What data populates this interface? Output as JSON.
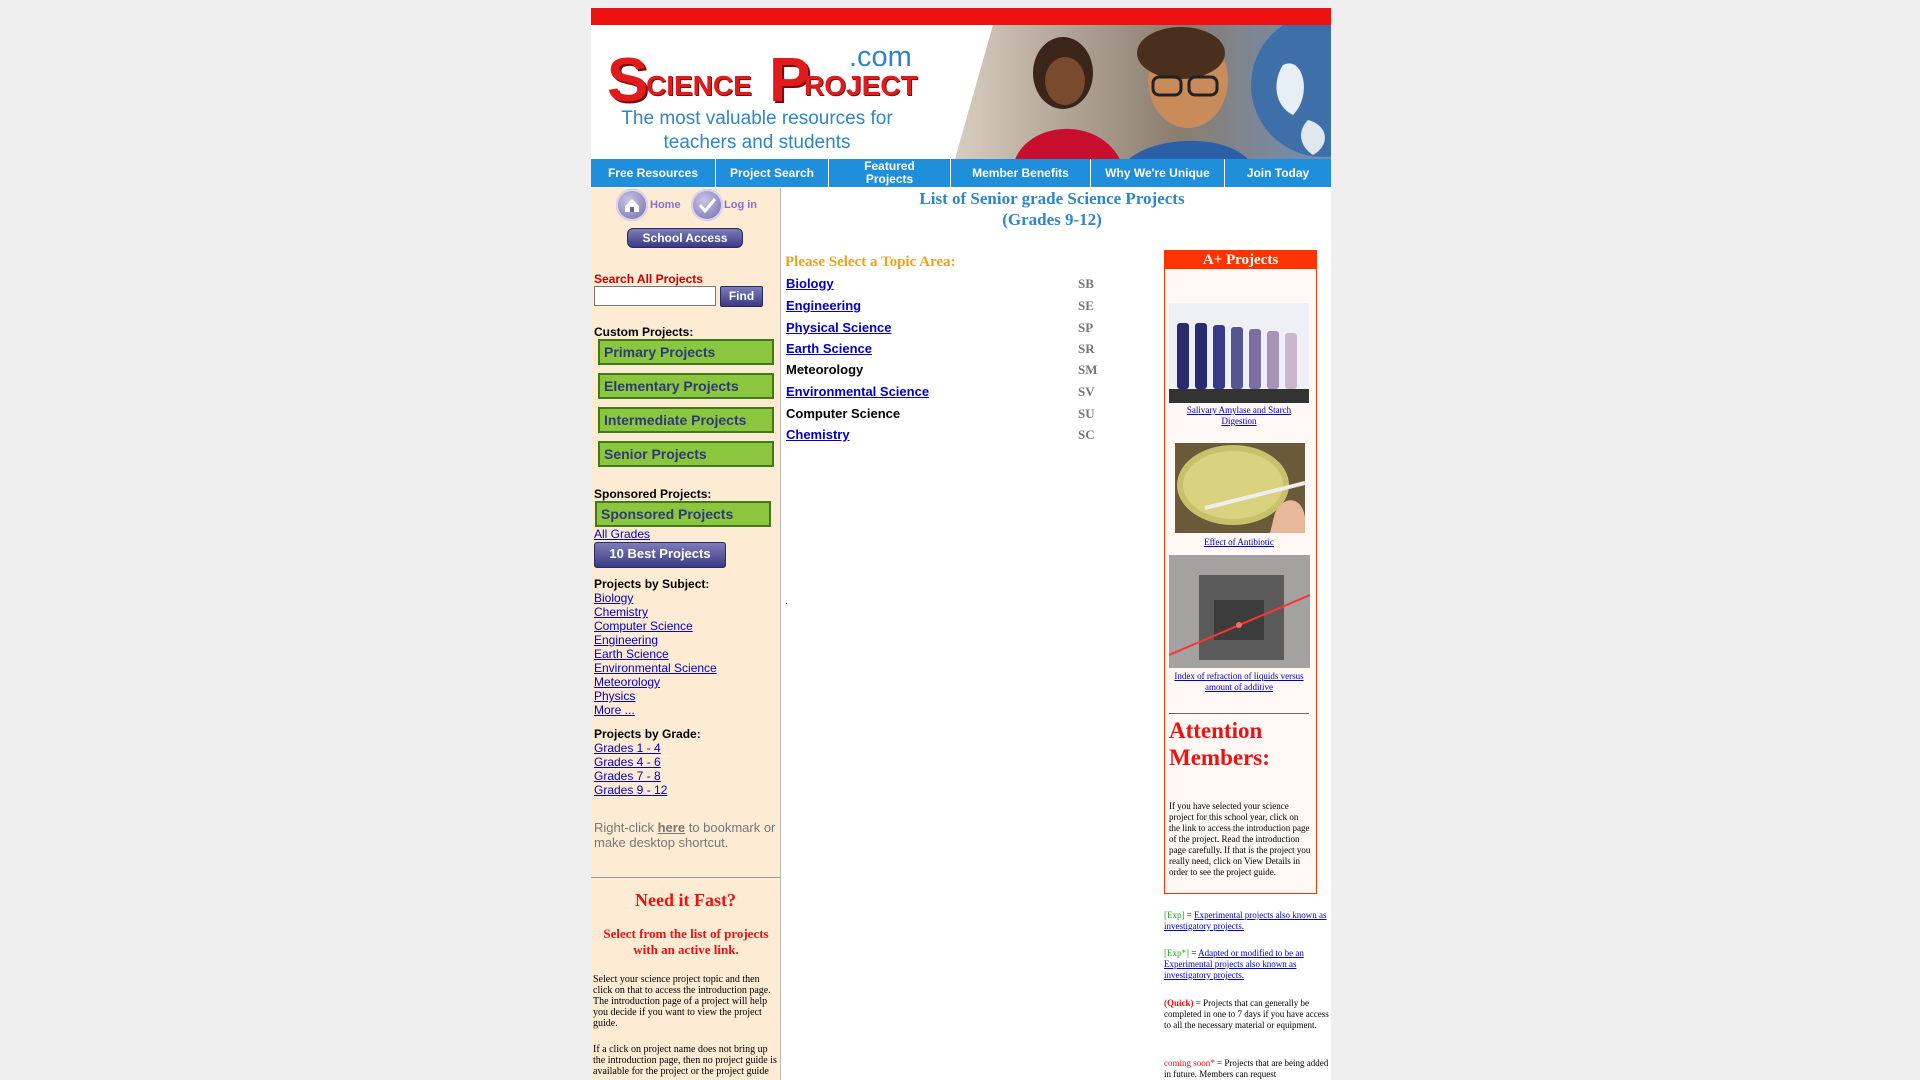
{
  "banner": {
    "logo_s": "S",
    "logo_cience": "CIENCE",
    "logo_p": "P",
    "logo_roject": "ROJECT",
    "logo_com": ".com",
    "tagline": "The most valuable resources for teachers and students"
  },
  "nav": [
    {
      "label": "Free Resources"
    },
    {
      "label": "Project Search"
    },
    {
      "label": "Featured Projects"
    },
    {
      "label": "Member Benefits"
    },
    {
      "label": "Why We're Unique"
    },
    {
      "label": "Join Today"
    }
  ],
  "sidebar": {
    "home": "Home",
    "login": "Log in",
    "school_access": "School Access",
    "search_label": "Search All Projects",
    "search_value": "",
    "find": "Find",
    "custom_label": "Custom Projects:",
    "custom": [
      "Primary Projects",
      "Elementary Projects",
      "Intermediate Projects",
      "Senior Projects"
    ],
    "sponsored_label": "Sponsored Projects:",
    "sponsored": "Sponsored Projects",
    "all_grades": "All Grades",
    "best": "10 Best Projects",
    "subject_label": "Projects by Subject:",
    "subjects": [
      "Biology",
      "Chemistry",
      "Computer Science",
      "Engineering",
      "Earth Science",
      "Environmental Science",
      "Meteorology",
      "Physics",
      "More ..."
    ],
    "grade_label": "Projects by Grade:",
    "grades": [
      "Grades 1 - 4",
      "Grades 4 - 6",
      "Grades 7 - 8",
      "Grades 9 - 12"
    ],
    "bookmark_pre": "Right-click",
    "bookmark_link": "here",
    "bookmark_post": "to bookmark or make desktop shortcut.",
    "need_fast": "Need it Fast?",
    "select_list": "Select from the list of projects with an active link.",
    "para1": "Select your science project topic and then click on that to access the introduction page. The introduction page of a project will help you decide if you want to view the project guide.",
    "para2": "If a click on project name does not bring up the introduction page, then no project guide is available for the project or the project guide"
  },
  "main": {
    "title1": "List of Senior grade Science Projects",
    "title2": "(Grades 9-12)",
    "topic_heading": "Please Select a Topic Area:",
    "topics": [
      {
        "name": "Biology",
        "code": "SB",
        "link": true
      },
      {
        "name": "Engineering",
        "code": "SE",
        "link": true
      },
      {
        "name": "Physical Science",
        "code": "SP",
        "link": true
      },
      {
        "name": "Earth Science",
        "code": "SR",
        "link": true
      },
      {
        "name": "Meteorology",
        "code": "SM",
        "link": false
      },
      {
        "name": "Environmental Science",
        "code": "SV",
        "link": true
      },
      {
        "name": "Computer Science",
        "code": "SU",
        "link": false
      },
      {
        "name": "Chemistry",
        "code": "SC",
        "link": true
      }
    ],
    "dot": "."
  },
  "right": {
    "aplus": "A+ Projects",
    "proj1": "Salivary Amylase and Starch Digestion",
    "proj2": "Effect of Antibiotic",
    "proj3": "Index of refraction of liquids versus amount of additive",
    "attention": "Attention Members:",
    "attention_text": "If you have selected your science project for this school year, click on the link to access the introduction page of the project. Read the introduction page carefully. If that is the project you really need, click on View Details in order to see the project guide.",
    "exp_tag": "[Exp]",
    "exp_text": "Experimental projects also known as investigatory projects.",
    "exp2_tag": "[Exp*]",
    "exp2_text": "Adapted or modified to be an Experimental projects also known as investigatory projects.",
    "quick_tag": "(Quick)",
    "quick_text": "= Projects that can generally be completed in one to 7 days if you have access to all the necessary material or equipment.",
    "soon_tag": "coming soon*",
    "soon_text": "= Projects that are being added in future. Members can request"
  },
  "colors": {
    "nav": "#1f8fdc",
    "red": "#ee1111",
    "sidebar": "#fdecd3",
    "green": "#8cc63f"
  }
}
